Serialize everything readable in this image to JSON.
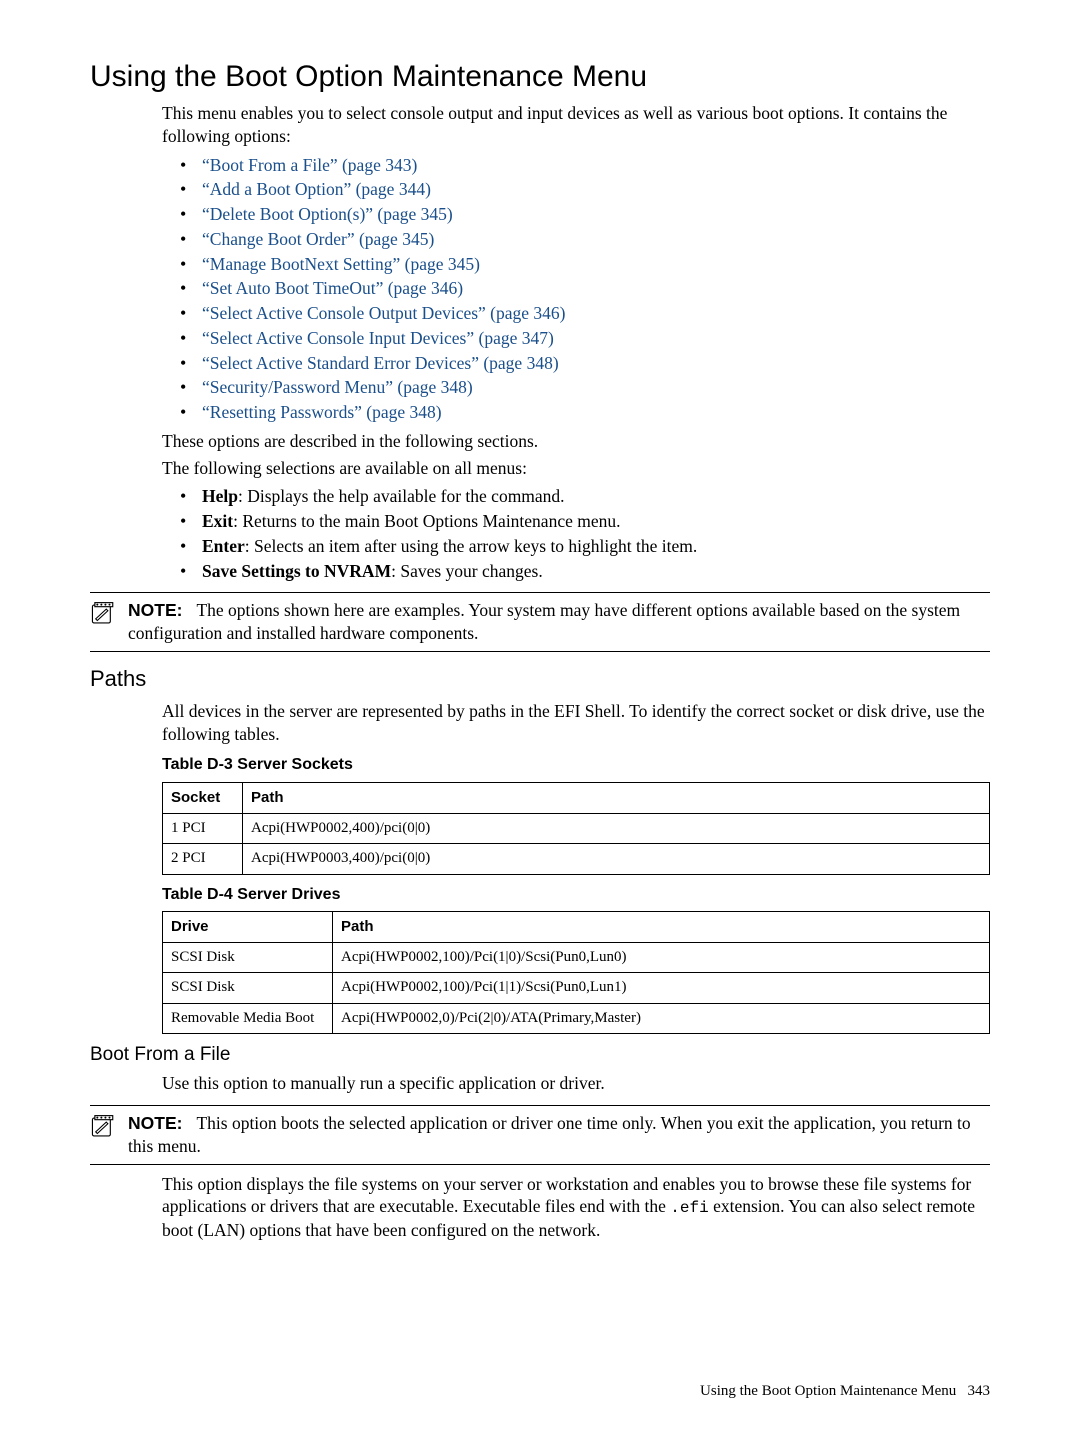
{
  "h1": "Using the Boot Option Maintenance Menu",
  "intro": "This menu enables you to select console output and input devices as well as various boot options. It contains the following options:",
  "toc": [
    "“Boot From a File” (page 343)",
    "“Add a Boot Option” (page 344)",
    "“Delete Boot Option(s)” (page 345)",
    "“Change Boot Order” (page 345)",
    "“Manage BootNext Setting” (page 345)",
    "“Set Auto Boot TimeOut” (page 346)",
    "“Select Active Console Output Devices” (page 346)",
    "“Select Active Console Input Devices” (page 347)",
    "“Select Active Standard Error Devices” (page 348)",
    "“Security/Password Menu” (page 348)",
    "“Resetting Passwords” (page 348)"
  ],
  "desc1": "These options are described in the following sections.",
  "desc2": "The following selections are available on all menus:",
  "menu_cmds": [
    {
      "label": "Help",
      "text": ": Displays the help available for the command."
    },
    {
      "label": "Exit",
      "text": ": Returns to the main Boot Options Maintenance menu."
    },
    {
      "label": "Enter",
      "text": ": Selects an item after using the arrow keys to highlight the item."
    },
    {
      "label": "Save Settings to NVRAM",
      "text": ": Saves your changes."
    }
  ],
  "note1": {
    "label": "NOTE:",
    "text": "The options shown here are examples. Your system may have different options available based on the system configuration and installed hardware components."
  },
  "paths": {
    "heading": "Paths",
    "intro": "All devices in the server are represented by paths in the EFI Shell. To identify the correct socket or disk drive, use the following tables.",
    "table1_caption": "Table D-3 Server Sockets",
    "table1_headers": [
      "Socket",
      "Path"
    ],
    "table1_rows": [
      [
        "1 PCI",
        "Acpi(HWP0002,400)/pci(0|0)"
      ],
      [
        "2 PCI",
        "Acpi(HWP0003,400)/pci(0|0)"
      ]
    ],
    "table2_caption": "Table D-4 Server Drives",
    "table2_headers": [
      "Drive",
      "Path"
    ],
    "table2_rows": [
      [
        "SCSI Disk",
        "Acpi(HWP0002,100)/Pci(1|0)/Scsi(Pun0,Lun0)"
      ],
      [
        "SCSI Disk",
        "Acpi(HWP0002,100)/Pci(1|1)/Scsi(Pun0,Lun1)"
      ],
      [
        "Removable Media Boot",
        "Acpi(HWP0002,0)/Pci(2|0)/ATA(Primary,Master)"
      ]
    ]
  },
  "boot_file": {
    "heading": "Boot From a File",
    "intro": "Use this option to manually run a specific application or driver.",
    "note": {
      "label": "NOTE:",
      "text": "This option boots the selected application or driver one time only. When you exit the application, you return to this menu."
    },
    "para_pre": "This option displays the file systems on your server or workstation and enables you to browse these file systems for applications or drivers that are executable. Executable files end with the ",
    "ext": ".efi",
    "para_post": " extension. You can also select remote boot (LAN) options that have been configured on the network."
  },
  "footer": {
    "text": "Using the Boot Option Maintenance Menu",
    "page": "343"
  }
}
